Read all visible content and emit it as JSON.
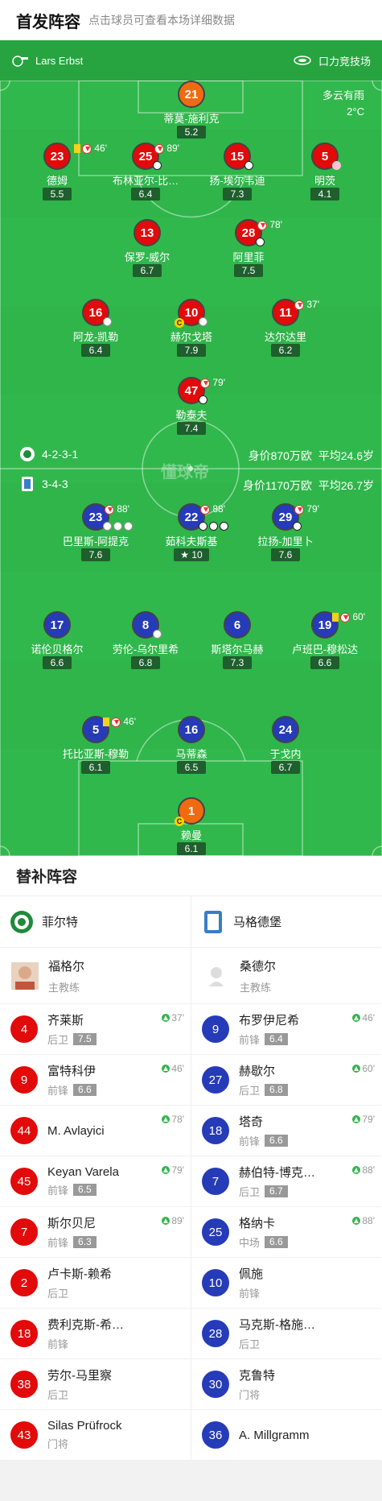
{
  "header": {
    "title": "首发阵容",
    "subtitle": "点击球员可查看本场详细数据"
  },
  "match": {
    "referee": "Lars Erbst",
    "venue": "口力竞技场",
    "weather": "多云有雨",
    "temperature": "2°C"
  },
  "home": {
    "formation": "4-2-3-1",
    "value": "身价870万欧",
    "avg_age": "平均24.6岁",
    "color": "#e20a0a",
    "gk": {
      "number": "21",
      "name": "蒂莫-施利克",
      "rating": "5.2"
    },
    "row1": [
      {
        "number": "23",
        "name": "德姆",
        "rating": "5.5",
        "ev": "46'"
      },
      {
        "number": "25",
        "name": "布林亚尔-比…",
        "rating": "6.4",
        "ev": "89'"
      },
      {
        "number": "15",
        "name": "扬-埃尔韦迪",
        "rating": "7.3"
      },
      {
        "number": "5",
        "name": "明茨",
        "rating": "4.1"
      }
    ],
    "row2": [
      {
        "number": "13",
        "name": "保罗-威尔",
        "rating": "6.7"
      },
      {
        "number": "28",
        "name": "阿里菲",
        "rating": "7.5",
        "ev": "78'"
      }
    ],
    "row3": [
      {
        "number": "16",
        "name": "阿龙-凯勒",
        "rating": "6.4"
      },
      {
        "number": "10",
        "name": "赫尔戈塔",
        "rating": "7.9"
      },
      {
        "number": "11",
        "name": "达尔达里",
        "rating": "6.2",
        "ev": "37'"
      }
    ],
    "row4": {
      "number": "47",
      "name": "勒泰夫",
      "rating": "7.4",
      "ev": "79'"
    }
  },
  "away": {
    "formation": "3-4-3",
    "value": "身价1170万欧",
    "avg_age": "平均26.7岁",
    "color": "#263bb8",
    "row1": [
      {
        "number": "23",
        "name": "巴里斯-阿提克",
        "rating": "7.6",
        "ev": "88'"
      },
      {
        "number": "22",
        "name": "茹科夫斯基",
        "rating": "10",
        "ev": "88'"
      },
      {
        "number": "29",
        "name": "拉扬-加里卜",
        "rating": "7.6",
        "ev": "79'"
      }
    ],
    "row2": [
      {
        "number": "17",
        "name": "诺伦贝格尔",
        "rating": "6.6"
      },
      {
        "number": "8",
        "name": "劳伦-乌尔里希",
        "rating": "6.8"
      },
      {
        "number": "6",
        "name": "斯塔尔马赫",
        "rating": "7.3"
      },
      {
        "number": "19",
        "name": "卢班巴-穆松达",
        "rating": "6.6",
        "ev": "60'"
      }
    ],
    "row3": [
      {
        "number": "5",
        "name": "托比亚斯-穆勒",
        "rating": "6.1",
        "ev": "46'"
      },
      {
        "number": "16",
        "name": "马蒂森",
        "rating": "6.5"
      },
      {
        "number": "24",
        "name": "于戈内",
        "rating": "6.7"
      }
    ],
    "gk": {
      "number": "1",
      "name": "赖曼",
      "rating": "6.1"
    }
  },
  "subs": {
    "title": "替补阵容",
    "home": {
      "team": "菲尔特",
      "coach": {
        "name": "福格尔",
        "role": "主教练"
      },
      "players": [
        {
          "number": "4",
          "name": "齐莱斯",
          "pos": "后卫",
          "rating": "7.5",
          "min": "37'"
        },
        {
          "number": "9",
          "name": "富特科伊",
          "pos": "前锋",
          "rating": "6.6",
          "min": "46'"
        },
        {
          "number": "44",
          "name": "M. Avlayici",
          "pos": "",
          "rating": "",
          "min": "78'"
        },
        {
          "number": "45",
          "name": "Keyan Varela",
          "pos": "前锋",
          "rating": "6.5",
          "min": "79'"
        },
        {
          "number": "7",
          "name": "斯尔贝尼",
          "pos": "前锋",
          "rating": "6.3",
          "min": "89'"
        },
        {
          "number": "2",
          "name": "卢卡斯-赖希",
          "pos": "后卫",
          "rating": "",
          "min": ""
        },
        {
          "number": "18",
          "name": "费利克斯-希…",
          "pos": "前锋",
          "rating": "",
          "min": ""
        },
        {
          "number": "38",
          "name": "劳尔-马里察",
          "pos": "后卫",
          "rating": "",
          "min": ""
        },
        {
          "number": "43",
          "name": "Silas Prüfrock",
          "pos": "门将",
          "rating": "",
          "min": ""
        }
      ]
    },
    "away": {
      "team": "马格德堡",
      "coach": {
        "name": "桑德尔",
        "role": "主教练"
      },
      "players": [
        {
          "number": "9",
          "name": "布罗伊尼希",
          "pos": "前锋",
          "rating": "6.4",
          "min": "46'"
        },
        {
          "number": "27",
          "name": "赫歇尔",
          "pos": "后卫",
          "rating": "6.8",
          "min": "60'"
        },
        {
          "number": "18",
          "name": "塔奇",
          "pos": "前锋",
          "rating": "6.6",
          "min": "79'"
        },
        {
          "number": "7",
          "name": "赫伯特-博克…",
          "pos": "后卫",
          "rating": "6.7",
          "min": "88'"
        },
        {
          "number": "25",
          "name": "格纳卡",
          "pos": "中场",
          "rating": "6.6",
          "min": "88'"
        },
        {
          "number": "10",
          "name": "佩施",
          "pos": "前锋",
          "rating": "",
          "min": ""
        },
        {
          "number": "28",
          "name": "马克斯-格施…",
          "pos": "后卫",
          "rating": "",
          "min": ""
        },
        {
          "number": "30",
          "name": "克鲁特",
          "pos": "门将",
          "rating": "",
          "min": ""
        },
        {
          "number": "36",
          "name": "A. Millgramm",
          "pos": "",
          "rating": "",
          "min": ""
        }
      ]
    }
  },
  "watermark": "懂球帝"
}
